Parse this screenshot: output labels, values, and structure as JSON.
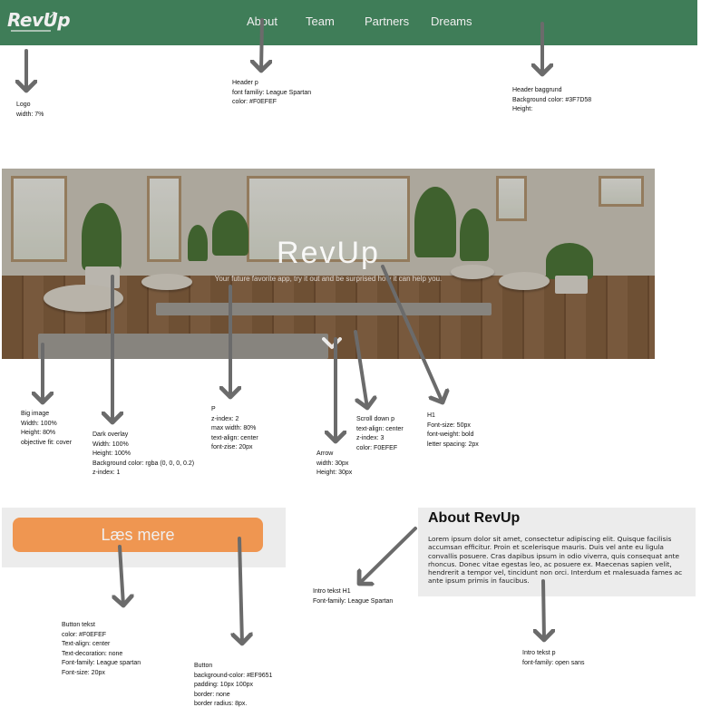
{
  "header": {
    "logo_text": "RevUp",
    "nav": [
      "About",
      "Team",
      "Partners",
      "Dreams"
    ],
    "background_color": "#3F7D58",
    "text_color": "#F0EFEF"
  },
  "hero": {
    "title": "RevUp",
    "subtitle": "Your future favorite app, try it out and be surprised how it can help you.",
    "scroll_icon": "chevron-down-icon"
  },
  "button": {
    "label": "Læs mere",
    "background_color": "#EF9651",
    "text_color": "#F0EFEF"
  },
  "intro": {
    "title": "About RevUp",
    "body": "Lorem ipsum dolor sit amet, consectetur adipiscing elit. Quisque facilisis accumsan efficitur. Proin et scelerisque mauris. Duis vel ante eu ligula convallis posuere. Cras dapibus ipsum in odio viverra, quis consequat ante rhoncus. Donec vitae egestas leo, ac posuere ex. Maecenas sapien velit, hendrerit a tempor vel, tincidunt non orci. Interdum et malesuada fames ac ante ipsum primis in faucibus."
  },
  "annotations": {
    "logo": "Logo\nwidth: 7%",
    "header_p": "Header p\nfont familiy: League Spartan\ncolor: #F0EFEF",
    "header_bg": "Header baggrund\nBackground color: #3F7D58\nHeight:",
    "big_image": "Big image\nWidth: 100%\nHeight: 80%\nobjective fit: cover",
    "dark_overlay": "Dark overlay\nWidth: 100%\nHeight: 100%\nBackground color: rgba (0, 0, 0, 0.2)\nz-index: 1",
    "p": "P\nz-index: 2\nmax width: 80%\ntext-align: center\nfont-zise: 20px",
    "arrow": "Arrow\nwidth: 30px\nHeight: 30px",
    "scroll_down": "Scroll down p\ntext-align: center\nz-index: 3\ncolor: F0EFEF",
    "h1": "H1\nFont-size: 50px\nfont-weight: bold\nletter spacing: 2px",
    "button_text": "Button tekst\ncolor: #F0EFEF\nText-align: center\nText-decoration: none\nFont-family: League spartan\nFont-size: 20px",
    "button_style": "Button\nbackground-color: #EF9651\npadding: 10px 100px\nborder: none\nborder radius: 8px.",
    "intro_h1": "Intro tekst H1\nFont-family: League Spartan",
    "intro_p": "Intro tekst p\nfont-family: open sans"
  }
}
